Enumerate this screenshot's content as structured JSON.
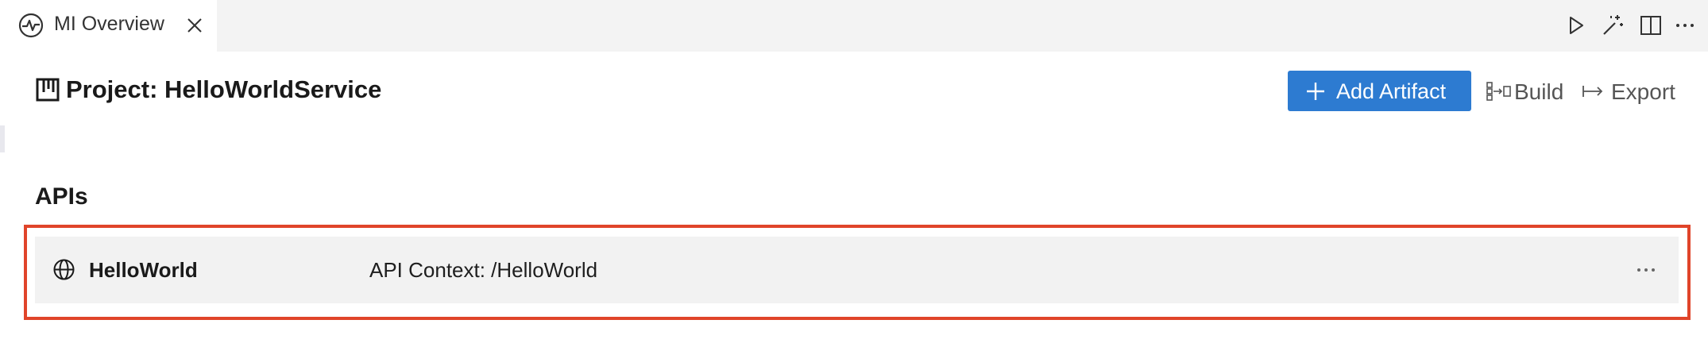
{
  "tab": {
    "title": "MI Overview",
    "icon": "pulse-icon"
  },
  "editor_actions": [
    "run-icon",
    "magic-wand-icon",
    "split-editor-icon",
    "more-actions-icon"
  ],
  "header": {
    "project_title": "Project: HelloWorldService",
    "add_artifact_label": "Add Artifact",
    "build_label": "Build",
    "export_label": "Export"
  },
  "apis": {
    "section_title": "APIs",
    "items": [
      {
        "name": "HelloWorld",
        "context": "API Context: /HelloWorld"
      }
    ]
  },
  "colors": {
    "accent": "#2d7bd1",
    "highlight": "#e0442a",
    "row_bg": "#f2f2f2",
    "tabbar_bg": "#f3f3f3"
  }
}
